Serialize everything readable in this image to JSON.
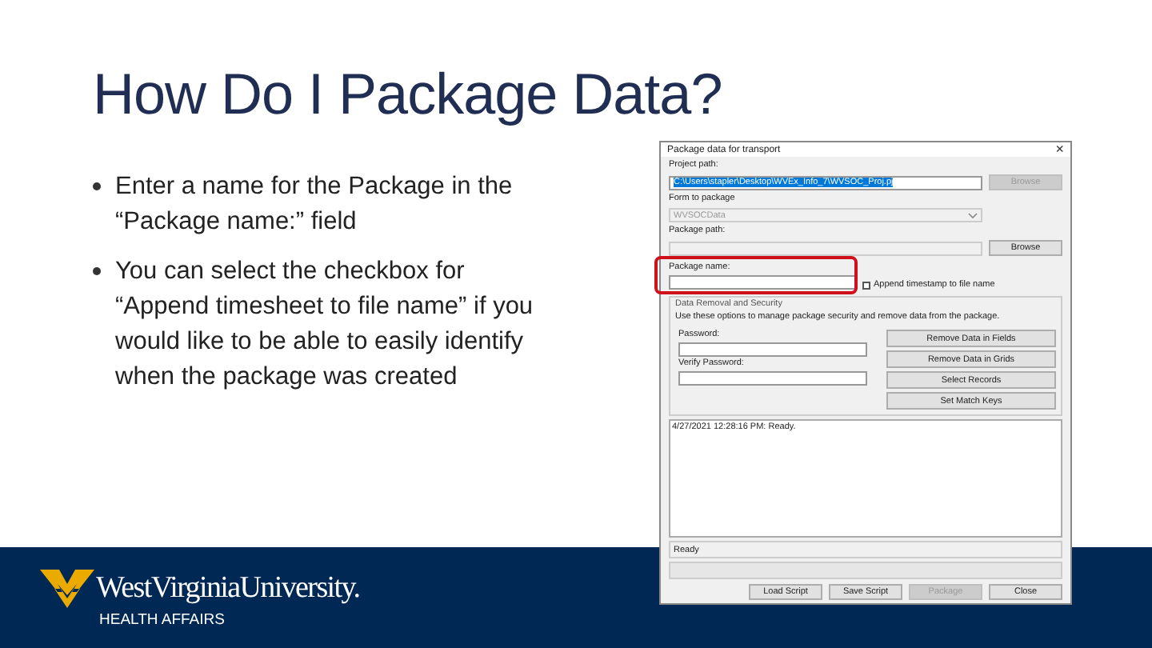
{
  "slide": {
    "title": "How Do I Package Data?",
    "bullets": [
      "Enter a name for the Package in the “Package name:” field",
      "You can select the checkbox for “Append timesheet to file name” if you would like to be able to easily identify when the package was created"
    ],
    "footer": {
      "wordmark": "WestVirginiaUniversity.",
      "subtitle": "HEALTH AFFAIRS"
    }
  },
  "dialog": {
    "title": "Package data for transport",
    "close": "×",
    "project_path": {
      "label": "Project path:",
      "value": "C:\\Users\\stapler\\Desktop\\WVEx_Info_7\\WVSOC_Proj.pj",
      "selected": true,
      "button": {
        "label": "Browse",
        "disabled": true
      }
    },
    "form": {
      "label": "Form to package",
      "value": "WVSOCData",
      "disabled": true
    },
    "package_path": {
      "label": "Package path:",
      "button": {
        "label": "Browse",
        "disabled": false
      }
    },
    "package_name": {
      "label": "Package name:",
      "highlighted": true
    },
    "append_timestamp": {
      "label": "Append timestamp to file name",
      "checked": false
    },
    "security": {
      "title": "Data Removal and Security",
      "description": "Use these options to manage package security and remove data from the package.",
      "fields": [
        {
          "label": "Password:"
        },
        {
          "label": "Verify Password:"
        }
      ],
      "buttons": [
        {
          "label": "Remove Data in Fields",
          "disabled": false
        },
        {
          "label": "Remove Data in Grids",
          "disabled": false
        },
        {
          "label": "Select Records",
          "disabled": false
        },
        {
          "label": "Set Match Keys",
          "disabled": false
        }
      ]
    },
    "log": [
      "4/27/2021 12:28:16 PM: Ready."
    ],
    "status": "Ready",
    "progress": {
      "level": 0
    },
    "buttons": [
      {
        "label": "Load Script",
        "disabled": false
      },
      {
        "label": "Save Script",
        "disabled": false
      },
      {
        "label": "Package",
        "disabled": true
      },
      {
        "label": "Close",
        "disabled": false
      }
    ]
  }
}
